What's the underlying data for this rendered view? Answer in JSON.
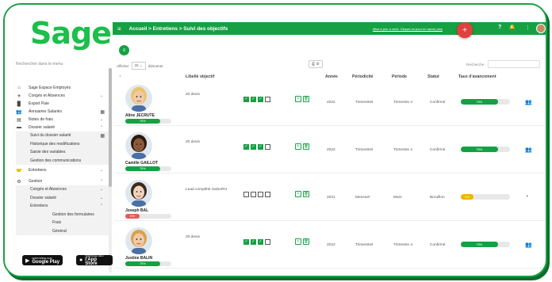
{
  "app": {
    "logo": "Sage",
    "search_placeholder": "Rechercher dans le menu"
  },
  "sidebar": {
    "items": [
      {
        "label": "Sage Espace Employés",
        "icon": "home-icon",
        "glyph": "⌂"
      },
      {
        "label": "Congés et Absences",
        "icon": "plane-icon",
        "glyph": "✈",
        "chev": "⌄"
      },
      {
        "label": "Export Paie",
        "icon": "file-icon",
        "glyph": "▉"
      },
      {
        "label": "Annuaires Salariés",
        "icon": "people-icon",
        "glyph": "👥",
        "grid": "▦"
      },
      {
        "label": "Notes de frais",
        "icon": "receipt-icon",
        "glyph": "▤",
        "chev": "⌄"
      },
      {
        "label": "Dossier salarié",
        "icon": "folder-icon",
        "glyph": "▬",
        "chev": "⌃"
      }
    ],
    "dossier_sub": [
      {
        "label": "Suivi du dossier salarié",
        "grid": "▦"
      },
      {
        "label": "Historique des modifications"
      },
      {
        "label": "Saisie des variables"
      },
      {
        "label": "Gestion des communications"
      }
    ],
    "entretiens": {
      "label": "Entretiens",
      "icon": "handshake-icon",
      "glyph": "🤝",
      "chev": "⌄"
    },
    "gestion": {
      "label": "Gestion",
      "icon": "gear-icon",
      "glyph": "⚙",
      "chev": "⌃"
    },
    "gestion_sub": [
      {
        "label": "Congés et Absences",
        "chev": "⌄"
      },
      {
        "label": "Dossier salarié",
        "chev": "⌄"
      },
      {
        "label": "Entretiens",
        "chev": "⌃"
      }
    ],
    "gestion_sub2": [
      {
        "label": "Gestion des formulaires"
      },
      {
        "label": "Frais"
      },
      {
        "label": "Général"
      }
    ],
    "google_play": {
      "small": "DISPONIBLE SUR",
      "big": "Google Play"
    },
    "app_store": {
      "small": "Télécharger dans",
      "big": "l'App Store"
    }
  },
  "topbar": {
    "breadcrumb": "Accueil > Entretiens > Suivi des objectifs",
    "notice": "Mise à jour à venir. Cliquez ici pour en savoir plus",
    "plus": "+",
    "help": "?",
    "bell": "🔔",
    "more": "⋮",
    "bg": "#15a143"
  },
  "toolbar": {
    "filter": "≡",
    "afficher": "Afficher",
    "entries": "25",
    "elements": "éléments",
    "tools": "⎙ ⊘",
    "recherche": "Recherche :"
  },
  "table": {
    "headers": {
      "sort": "↑",
      "libelle": "Libellé objectif",
      "annee": "Année",
      "periodicite": "Périodicité",
      "periode": "Période",
      "statut": "Statut",
      "taux": "Taux d'avancement"
    },
    "rows": [
      {
        "name": "Aline JECRUTE",
        "progress_label": "75%",
        "progress": 75,
        "progress_color": "#15a143",
        "libelle": "20 devis",
        "checks": [
          true,
          true,
          true,
          false
        ],
        "annee": "2022",
        "periodicite": "Trimestriel",
        "periode": "Trimestre 4",
        "statut": "Confirmé",
        "taux_label": "75%",
        "taux": 75,
        "taux_color": "#15a143",
        "icon_glyph": "👥",
        "skin": "#f2c9a8",
        "hair": "#e9c46a"
      },
      {
        "name": "Camille GAILLOT",
        "progress_label": "75%",
        "progress": 75,
        "progress_color": "#15a143",
        "libelle": "20 devis",
        "checks": [
          true,
          true,
          true,
          false
        ],
        "annee": "2022",
        "periodicite": "Trimestriel",
        "periode": "Trimestre 4",
        "statut": "Confirmé",
        "taux_label": "75%",
        "taux": 75,
        "taux_color": "#15a143",
        "icon_glyph": "👥",
        "skin": "#8a5a3b",
        "hair": "#2b1a10"
      },
      {
        "name": "Joseph BAL",
        "progress_label": "0%",
        "progress": 0,
        "progress_color": "#e35b5b",
        "libelle": "Lead complété SalonRH",
        "checks": [
          false,
          false,
          false,
          false
        ],
        "annee": "2021",
        "periodicite": "Mensuel",
        "periode": "Mars",
        "statut": "Brouillon",
        "taux_label": "0%",
        "taux": 0,
        "taux_color": "#f0b400",
        "icon_glyph": "◔",
        "skin": "#f1d3bc",
        "hair": "#3b2a20"
      },
      {
        "name": "Justine BALIN",
        "progress_label": "75%",
        "progress": 75,
        "progress_color": "#15a143",
        "libelle": "20 devis",
        "checks": [
          true,
          true,
          true,
          false
        ],
        "annee": "2022",
        "periodicite": "Trimestriel",
        "periode": "Trimestre 4",
        "statut": "Confirmé",
        "taux_label": "75%",
        "taux": 75,
        "taux_color": "#15a143",
        "icon_glyph": "👥",
        "skin": "#f2c9a8",
        "hair": "#d8a24a"
      }
    ],
    "edit_glyph": "✎",
    "delete_glyph": "🗑",
    "check_glyph": "✓"
  }
}
